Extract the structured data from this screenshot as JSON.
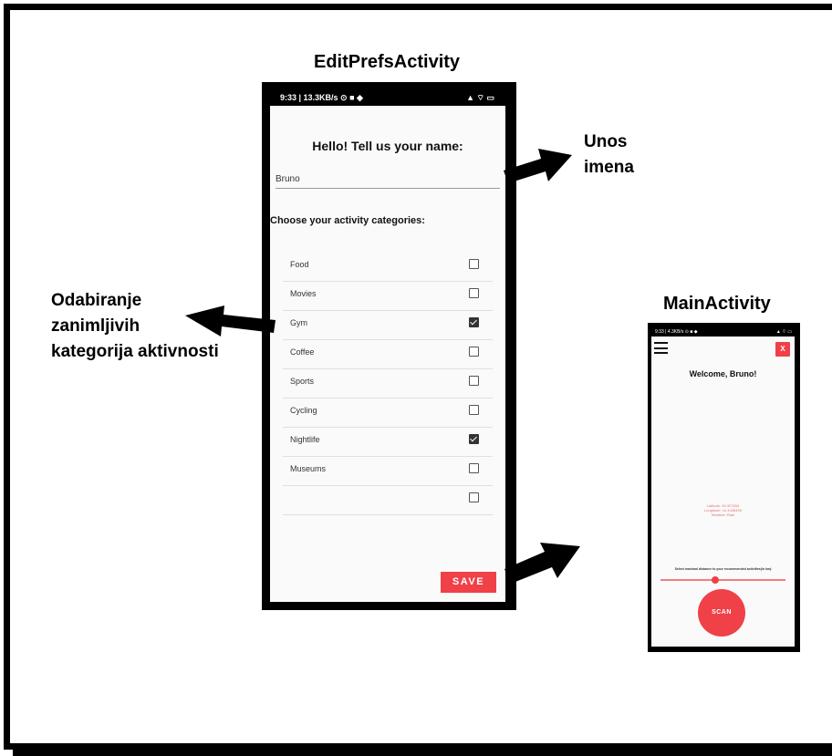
{
  "labels": {
    "edit_prefs_title": "EditPrefsActivity",
    "main_title": "MainActivity",
    "unos_line1": "Unos",
    "unos_line2": "imena",
    "odabir_line1": "Odabiranje",
    "odabir_line2": "zanimljivih",
    "odabir_line3": "kategorija aktivnosti"
  },
  "edit_prefs": {
    "status_left": "9:33 | 13.3KB/s ⊙ ■ ◆",
    "status_right": "▲ ⌔ ▭",
    "greeting": "Hello! Tell us your name:",
    "name_value": "Bruno",
    "categories_heading": "Choose your activity categories:",
    "categories": [
      {
        "label": "Food",
        "checked": false
      },
      {
        "label": "Movies",
        "checked": false
      },
      {
        "label": "Gym",
        "checked": true
      },
      {
        "label": "Coffee",
        "checked": false
      },
      {
        "label": "Sports",
        "checked": false
      },
      {
        "label": "Cycling",
        "checked": false
      },
      {
        "label": "Nightlife",
        "checked": true
      },
      {
        "label": "Museums",
        "checked": false
      },
      {
        "label": "",
        "checked": false
      }
    ],
    "save_label": "SAVE"
  },
  "main": {
    "status_left": "9:33 | 4.3KB/s ⊙ ■ ◆",
    "status_right": "▲ ⌔ ▭",
    "close_label": "X",
    "welcome": "Welcome, Bruno!",
    "location_lines": [
      "Latitude: 45.327854",
      "Longitude: 14.4438499",
      "Weather: Rain"
    ],
    "distance_label": "Select maximal distance to your recommended activities(in km):",
    "slider_fraction": 0.44,
    "scan_label": "SCAN"
  },
  "colors": {
    "accent": "#ef4147",
    "frame": "#000000"
  }
}
